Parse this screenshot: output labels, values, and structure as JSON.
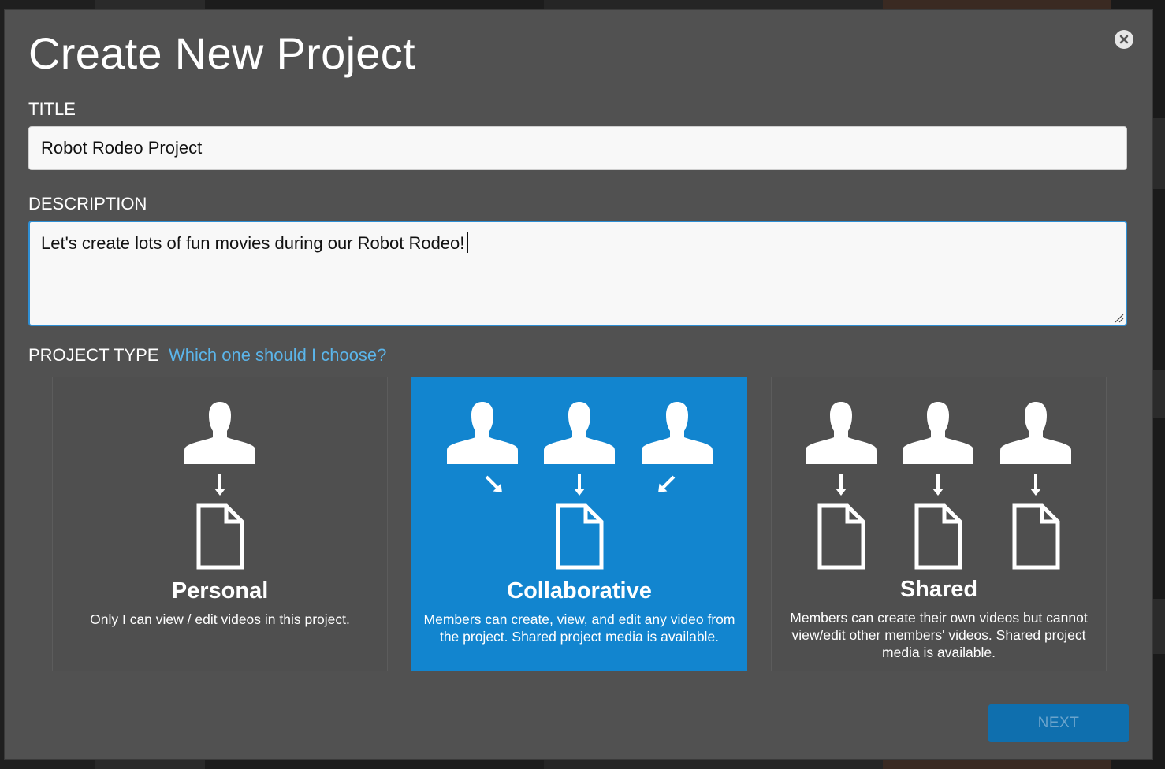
{
  "modal": {
    "title": "Create New Project",
    "close_icon": "close-circle-icon"
  },
  "form": {
    "title_label": "TITLE",
    "title_value": "Robot Rodeo Project",
    "description_label": "DESCRIPTION",
    "description_value": "Let's create lots of fun movies during our Robot Rodeo!",
    "project_type_label": "PROJECT TYPE",
    "help_link": "Which one should I choose?"
  },
  "project_types": [
    {
      "name": "Personal",
      "description": "Only I can view / edit videos in this project.",
      "selected": false,
      "icon": "single-user-to-document-icon"
    },
    {
      "name": "Collaborative",
      "description": "Members can create, view, and edit any video from the project. Shared project media is available.",
      "selected": true,
      "icon": "users-to-one-document-icon"
    },
    {
      "name": "Shared",
      "description": "Members can create their own videos but cannot view/edit other members' videos. Shared project media is available.",
      "selected": false,
      "icon": "users-to-own-documents-icon"
    }
  ],
  "actions": {
    "next_label": "NEXT"
  },
  "colors": {
    "modal_background": "#515151",
    "selected_card": "#1285cf",
    "link": "#5bb5ea",
    "focus_border": "#2e8fd4",
    "next_button": "#0f6fae"
  }
}
